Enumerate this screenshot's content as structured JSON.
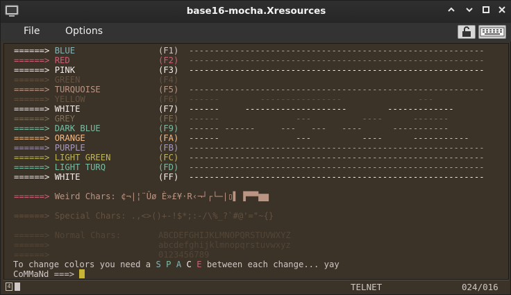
{
  "window": {
    "title": "base16-mocha.Xresources",
    "controls": {
      "minimize": "⌃",
      "restore": "⌄",
      "maximize": "□",
      "close": "✕"
    }
  },
  "menu": {
    "file": "File",
    "options": "Options"
  },
  "terminal": {
    "colors": [
      {
        "arrow": "======>",
        "name": "BLUE",
        "code": "(F1)",
        "bar": "----------------------------------------------------------"
      },
      {
        "arrow": "======>",
        "name": "RED",
        "code": "(F2)",
        "bar": "----------------------------------------------------------"
      },
      {
        "arrow": "======>",
        "name": "PINK",
        "code": "(F3)",
        "bar": "----------------------------------------------------------"
      },
      {
        "arrow": "======>",
        "name": "GREEN",
        "code": "(F4)",
        "bar": ""
      },
      {
        "arrow": "======>",
        "name": "TURQUOISE",
        "code": "(F5)",
        "bar": "----------------------------------------------------------"
      },
      {
        "arrow": "======>",
        "name": "YELLOW",
        "code": "(F6)",
        "bar": "------        ----------------               ---"
      },
      {
        "arrow": "======>",
        "name": "WHITE",
        "code": "(F7)",
        "bar": "------     --------------------        -------------"
      },
      {
        "arrow": "======>",
        "name": "GREY",
        "code": "(FE)",
        "bar": "------               ---          ----      -------"
      },
      {
        "arrow": "======>",
        "name": "DARK BLUE",
        "code": "(F9)",
        "bar": "------ ------     ---   ---   ----      -----------"
      },
      {
        "arrow": "======>",
        "name": "ORANGE",
        "code": "(FA)",
        "bar": "------               ---          ----      -----------"
      },
      {
        "arrow": "======>",
        "name": "PURPLE",
        "code": "(FB)",
        "bar": "----------------------------------------------------------"
      },
      {
        "arrow": "======>",
        "name": "LIGHT GREEN",
        "code": "(FC)",
        "bar": "----------------------------------------------------------"
      },
      {
        "arrow": "======>",
        "name": "LIGHT TURQ",
        "code": "(FD)",
        "bar": "----------------------------------------------------------"
      },
      {
        "arrow": "======>",
        "name": "WHITE",
        "code": "(FF)",
        "bar": "----------------------------------------------------------"
      }
    ],
    "weird": {
      "arrow": "======>",
      "label": "Weird Chars:",
      "chars": "¢¬|¦¨Ûø È»£¥·R‹¬┘┌└─|▯▌ ▛▀▀▆▆"
    },
    "special": {
      "arrow": "======>",
      "label": "Special Chars:",
      "chars": ".,<>()+-!$*;:-/\\%_?`#@'=\"~{}"
    },
    "normal": {
      "arrow": "======>",
      "label": "Normal Chars:",
      "upper": "ABCDEFGHIJKLMNOPQRSTUVWXYZ",
      "lower": "abcdefghijklmnopqrstuvwxyz",
      "digits": "0123456789"
    },
    "instruction": {
      "pre": "To change colors you need a",
      "s": "S",
      "p": "P",
      "a": "A",
      "c": "C",
      "e": "E",
      "post": "between each change... yay"
    },
    "prompt": "CoMMaNd ===>"
  },
  "status": {
    "mode": "TELNET",
    "position": "024/016"
  }
}
